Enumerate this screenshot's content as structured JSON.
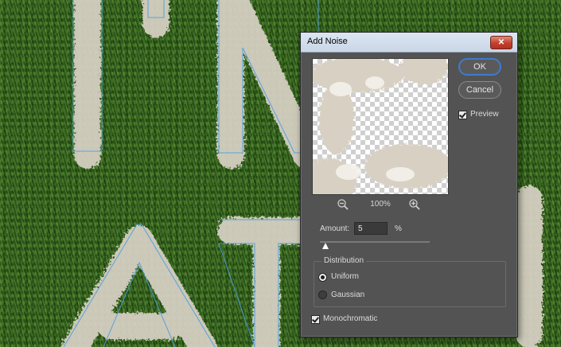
{
  "dialog": {
    "title": "Add Noise",
    "close_label": "✕",
    "ok_label": "OK",
    "cancel_label": "Cancel",
    "preview_label": "Preview",
    "preview_checked": true,
    "zoom_level": "100%",
    "amount_label": "Amount:",
    "amount_value": "5",
    "amount_unit": "%",
    "amount_slider_fraction": 0.05,
    "distribution_label": "Distribution",
    "uniform_label": "Uniform",
    "gaussian_label": "Gaussian",
    "selected_distribution": "Uniform",
    "monochromatic_label": "Monochromatic",
    "monochromatic_checked": true
  },
  "canvas": {
    "background": "grass-texture",
    "fur_color": "#d9d2c6",
    "outline_color": "#4a9ee0"
  },
  "icons": {
    "zoom_out": "zoom-out-icon",
    "zoom_in": "zoom-in-icon",
    "close": "close-icon"
  }
}
